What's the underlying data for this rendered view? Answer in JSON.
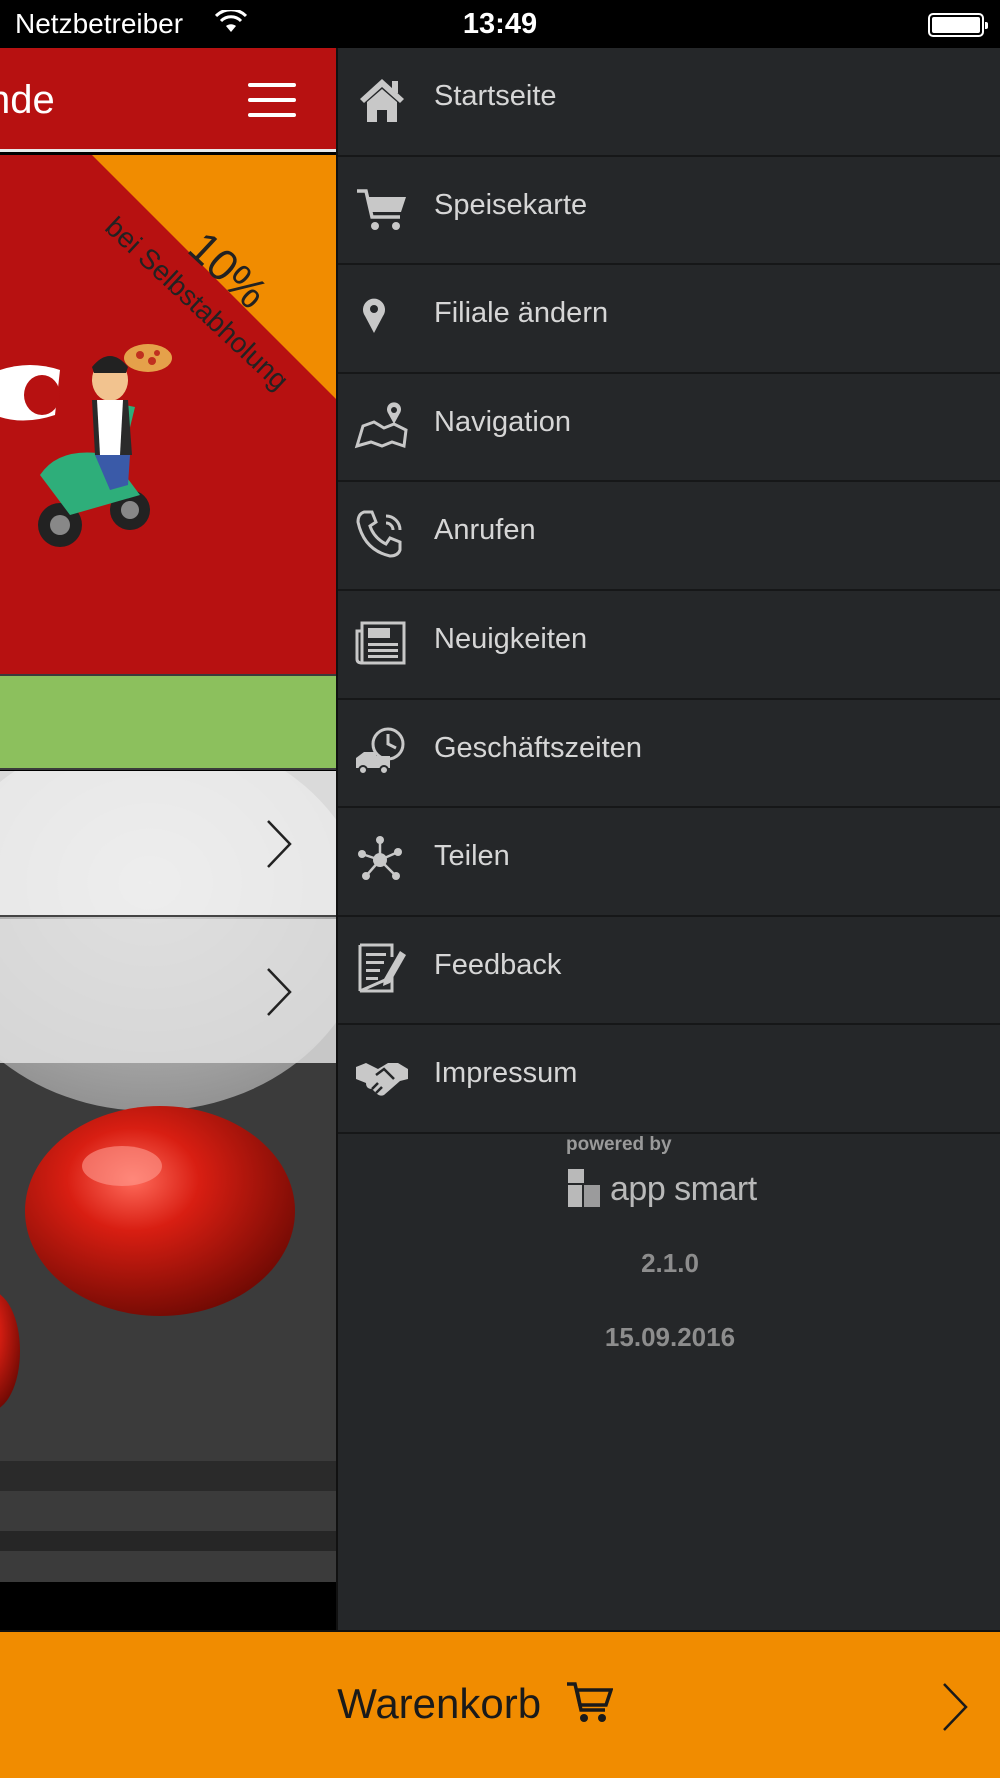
{
  "status_bar": {
    "carrier": "Netzbetreiber",
    "time": "13:49"
  },
  "app": {
    "header_title": "nde",
    "promo": {
      "percent": "10%",
      "text": "bei Selbstabholung"
    }
  },
  "menu": {
    "items": [
      {
        "label": "Startseite",
        "icon": "home-icon"
      },
      {
        "label": "Speisekarte",
        "icon": "cart-icon"
      },
      {
        "label": "Filiale ändern",
        "icon": "map-pin-icon"
      },
      {
        "label": "Navigation",
        "icon": "map-icon"
      },
      {
        "label": "Anrufen",
        "icon": "phone-icon"
      },
      {
        "label": "Neuigkeiten",
        "icon": "newspaper-icon"
      },
      {
        "label": "Geschäftszeiten",
        "icon": "delivery-clock-icon"
      },
      {
        "label": "Teilen",
        "icon": "share-icon"
      },
      {
        "label": "Feedback",
        "icon": "feedback-icon"
      },
      {
        "label": "Impressum",
        "icon": "handshake-icon"
      }
    ],
    "footer": {
      "powered_by": "powered by",
      "brand": "app smart",
      "version": "2.1.0",
      "date": "15.09.2016"
    }
  },
  "cart": {
    "label": "Warenkorb"
  },
  "colors": {
    "brand_red": "#b71111",
    "accent_orange": "#f18c00",
    "menu_bg": "#252729",
    "green": "#8cc05d"
  }
}
